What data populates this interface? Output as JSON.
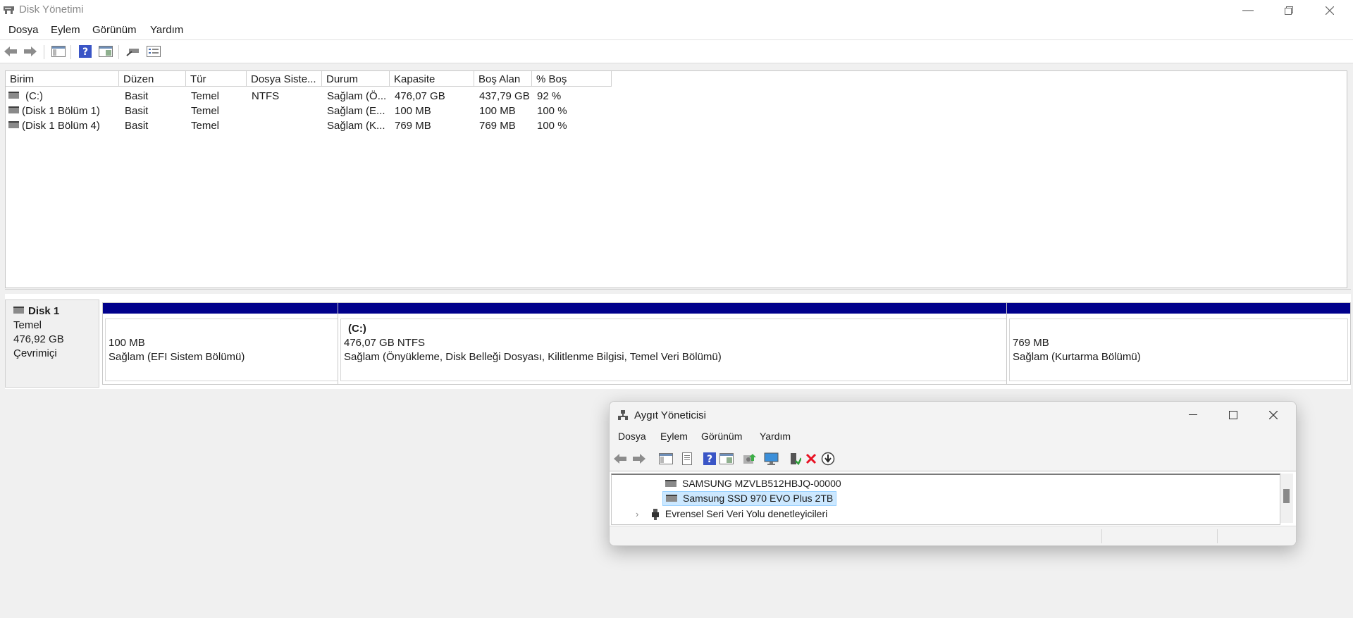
{
  "window": {
    "title": "Disk Yönetimi"
  },
  "menu": [
    "Dosya",
    "Eylem",
    "Görünüm",
    "Yardım"
  ],
  "list": {
    "headers": [
      "Birim",
      "Düzen",
      "Tür",
      "Dosya Siste...",
      "Durum",
      "Kapasite",
      "Boş Alan",
      "% Boş"
    ],
    "rows": [
      [
        "(C:)",
        "Basit",
        "Temel",
        "NTFS",
        "Sağlam (Ö...",
        "476,07 GB",
        "437,79 GB",
        "92 %"
      ],
      [
        "(Disk 1 Bölüm 1)",
        "Basit",
        "Temel",
        "",
        "Sağlam (E...",
        "100 MB",
        "100 MB",
        "100 %"
      ],
      [
        "(Disk 1 Bölüm 4)",
        "Basit",
        "Temel",
        "",
        "Sağlam (K...",
        "769 MB",
        "769 MB",
        "100 %"
      ]
    ]
  },
  "disk": {
    "name": "Disk 1",
    "type": "Temel",
    "size": "476,92 GB",
    "status": "Çevrimiçi",
    "partitions": [
      {
        "label": "",
        "size": "100 MB",
        "status": "Sağlam (EFI Sistem Bölümü)"
      },
      {
        "label": "(C:)",
        "size": "476,07 GB NTFS",
        "status": "Sağlam (Önyükleme, Disk Belleği Dosyası, Kilitlenme Bilgisi, Temel Veri Bölümü)"
      },
      {
        "label": "",
        "size": "769 MB",
        "status": "Sağlam (Kurtarma Bölümü)"
      }
    ]
  },
  "device_manager": {
    "title": "Aygıt Yöneticisi",
    "menu": [
      "Dosya",
      "Eylem",
      "Görünüm",
      "Yardım"
    ],
    "tree": [
      {
        "label": "SAMSUNG MZVLB512HBJQ-00000",
        "selected": false
      },
      {
        "label": "Samsung SSD 970 EVO Plus 2TB",
        "selected": true
      },
      {
        "label": "Evrensel Seri Veri Yolu denetleyicileri",
        "selected": false,
        "expander": "›"
      }
    ]
  },
  "colors": {
    "partition_band": "#00008b",
    "selection": "#cce8ff",
    "delete": "#e81123"
  }
}
